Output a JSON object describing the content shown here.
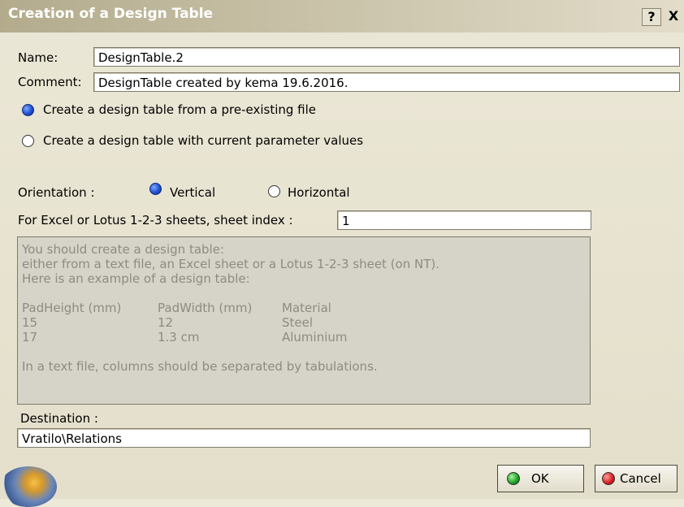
{
  "window": {
    "title": "Creation of a Design Table",
    "help_label": "?",
    "close_label": "X"
  },
  "name": {
    "label": "Name:",
    "value": "DesignTable.2"
  },
  "comment": {
    "label": "Comment:",
    "value": "DesignTable created by kema 19.6.2016."
  },
  "source_options": [
    {
      "label": "Create a design table from a pre-existing file",
      "selected": true
    },
    {
      "label": "Create a design table with current parameter values",
      "selected": false
    }
  ],
  "orientation": {
    "label": "Orientation :",
    "options": [
      {
        "label": "Vertical",
        "selected": true
      },
      {
        "label": "Horizontal",
        "selected": false
      }
    ]
  },
  "sheet_index": {
    "label": "For Excel or Lotus 1-2-3 sheets, sheet index :",
    "value": "1"
  },
  "info": {
    "lines": [
      "You should create a design table:",
      "either from a text file, an Excel sheet or a Lotus 1-2-3 sheet (on NT).",
      "Here is an example of a design table:"
    ],
    "table": [
      [
        "PadHeight (mm)",
        "PadWidth (mm)",
        "Material"
      ],
      [
        "15",
        "12",
        "Steel"
      ],
      [
        "17",
        "1.3 cm",
        "Aluminium"
      ]
    ],
    "footer": "In a text file, columns should be separated by tabulations."
  },
  "destination": {
    "label": "Destination :",
    "value": "Vratilo\\Relations"
  },
  "buttons": {
    "ok": "OK",
    "cancel": "Cancel"
  },
  "colors": {
    "ok_icon": "#1a9e20",
    "cancel_icon": "#d81b1b",
    "radio_selected": "#1f4fd1"
  }
}
